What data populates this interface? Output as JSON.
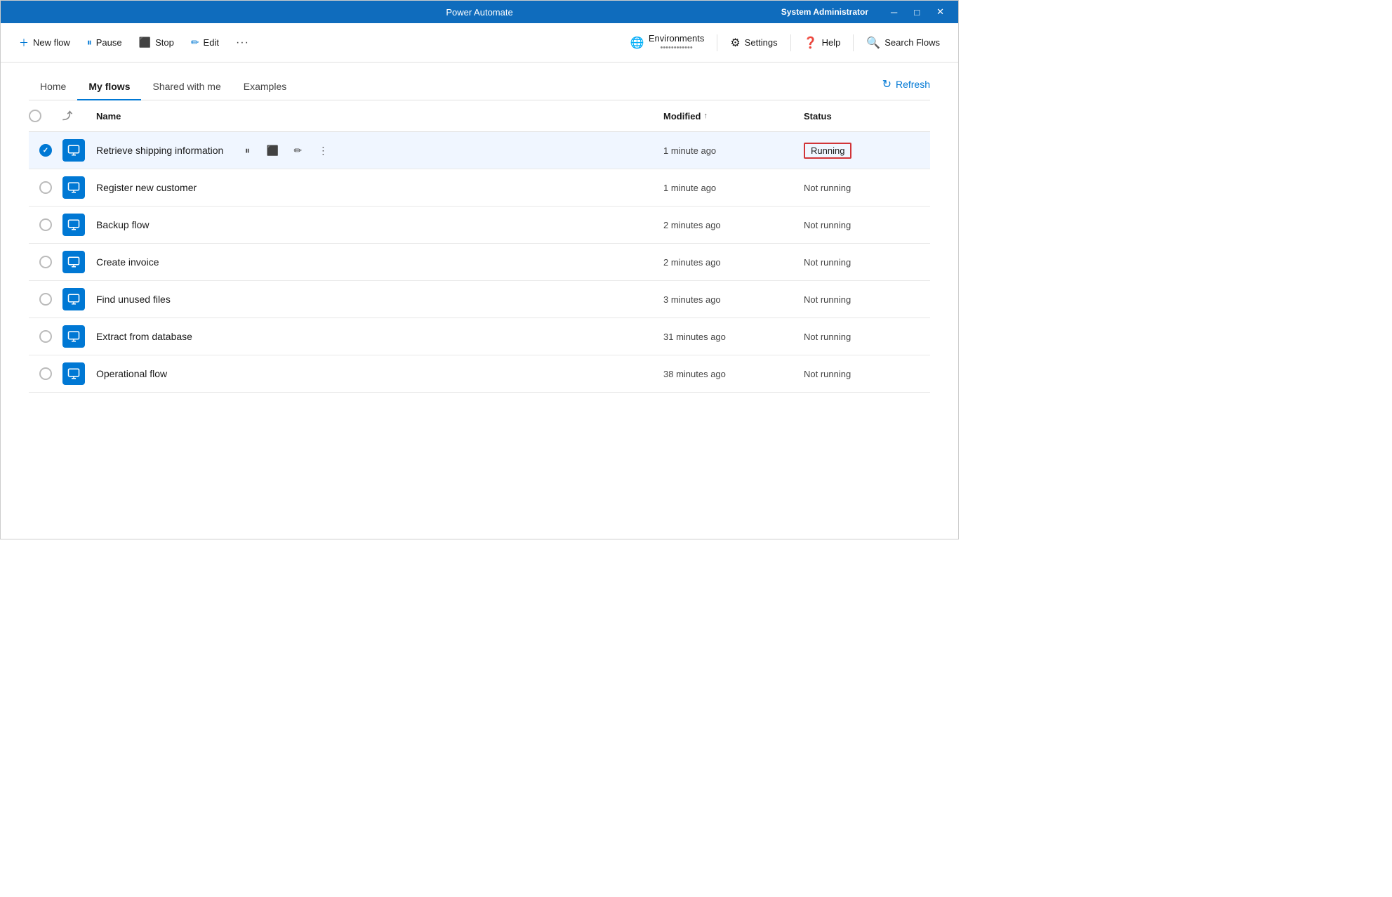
{
  "titleBar": {
    "title": "Power Automate",
    "user": "System Administrator",
    "controls": {
      "minimize": "─",
      "maximize": "□",
      "close": "✕"
    }
  },
  "toolbar": {
    "newFlow": "New flow",
    "pause": "Pause",
    "stop": "Stop",
    "edit": "Edit",
    "more": "···",
    "environments": "Environments",
    "environmentsSub": "••••••••••••",
    "settings": "Settings",
    "help": "Help",
    "searchFlows": "Search Flows"
  },
  "tabs": {
    "items": [
      {
        "label": "Home",
        "active": false
      },
      {
        "label": "My flows",
        "active": true
      },
      {
        "label": "Shared with me",
        "active": false
      },
      {
        "label": "Examples",
        "active": false
      }
    ],
    "refreshLabel": "Refresh"
  },
  "table": {
    "columns": {
      "name": "Name",
      "modified": "Modified",
      "status": "Status"
    },
    "rows": [
      {
        "id": 1,
        "name": "Retrieve shipping information",
        "modified": "1 minute ago",
        "status": "Running",
        "selected": true,
        "statusStyle": "running"
      },
      {
        "id": 2,
        "name": "Register new customer",
        "modified": "1 minute ago",
        "status": "Not running",
        "selected": false,
        "statusStyle": "normal"
      },
      {
        "id": 3,
        "name": "Backup flow",
        "modified": "2 minutes ago",
        "status": "Not running",
        "selected": false,
        "statusStyle": "normal"
      },
      {
        "id": 4,
        "name": "Create invoice",
        "modified": "2 minutes ago",
        "status": "Not running",
        "selected": false,
        "statusStyle": "normal"
      },
      {
        "id": 5,
        "name": "Find unused files",
        "modified": "3 minutes ago",
        "status": "Not running",
        "selected": false,
        "statusStyle": "normal"
      },
      {
        "id": 6,
        "name": "Extract from database",
        "modified": "31 minutes ago",
        "status": "Not running",
        "selected": false,
        "statusStyle": "normal"
      },
      {
        "id": 7,
        "name": "Operational flow",
        "modified": "38 minutes ago",
        "status": "Not running",
        "selected": false,
        "statusStyle": "normal"
      }
    ]
  }
}
